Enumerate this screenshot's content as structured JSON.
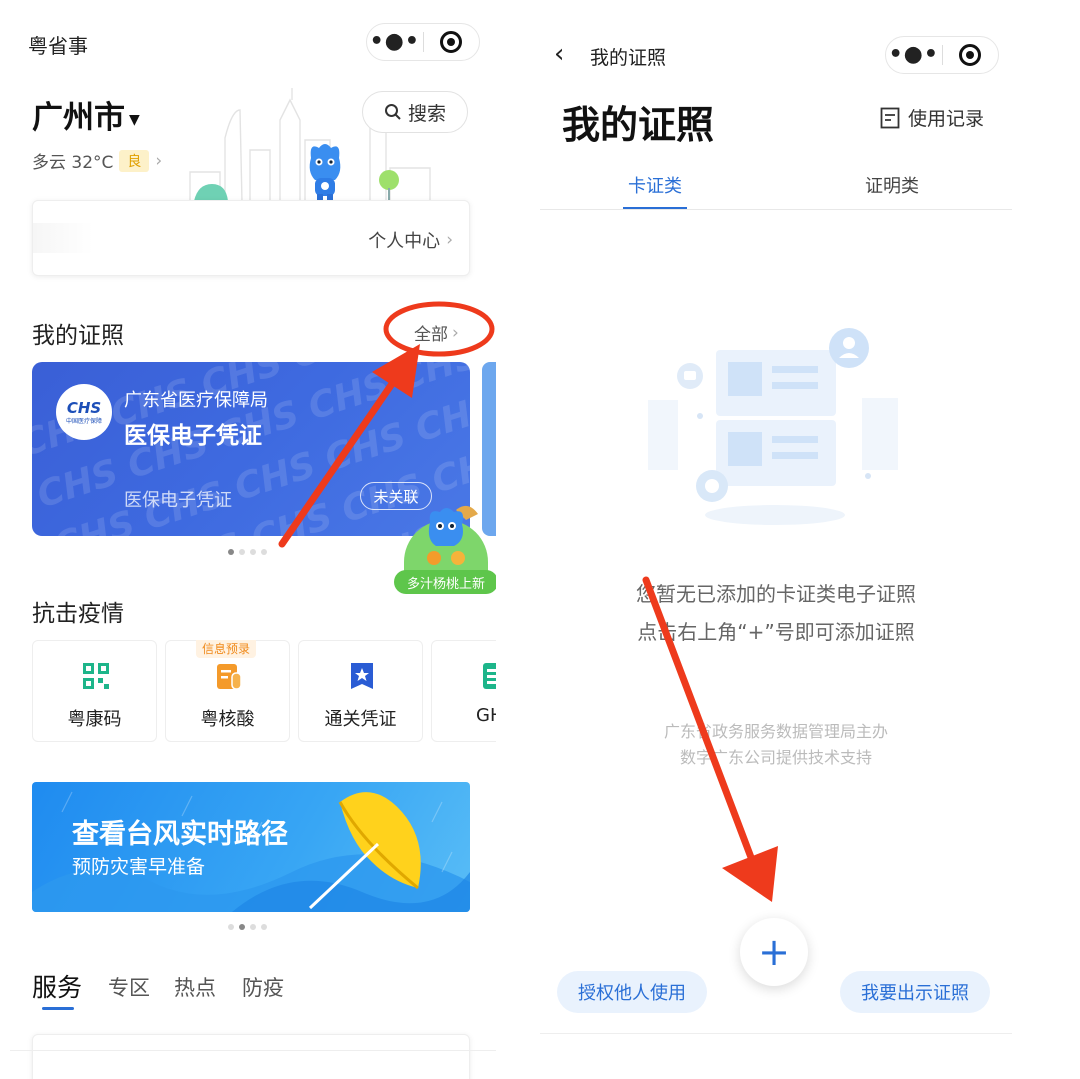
{
  "left": {
    "app_title": "粤省事",
    "city": "广州市",
    "search_label": "搜索",
    "weather": "多云 32°C",
    "air_quality": "良",
    "personal_center": "个人中心",
    "certs_section_title": "我的证照",
    "certs_all_link": "全部",
    "med_card": {
      "org": "广东省医疗保障局",
      "title": "医保电子凭证",
      "subtitle": "医保电子凭证",
      "status": "未关联",
      "logo_text": "CHS",
      "logo_caption": "中国医疗保障"
    },
    "promo_badge": "多汁杨桃上新",
    "epidemic_title": "抗击疫情",
    "epidemic_items": [
      {
        "label": "粤康码",
        "tag": ""
      },
      {
        "label": "粤核酸",
        "tag": "信息预录"
      },
      {
        "label": "通关凭证",
        "tag": ""
      },
      {
        "label": "GH",
        "tag": ""
      }
    ],
    "banner": {
      "title": "查看台风实时路径",
      "subtitle": "预防灾害早准备"
    },
    "bottom_tabs": [
      "服务",
      "专区",
      "热点",
      "防疫"
    ]
  },
  "right": {
    "nav_title": "我的证照",
    "page_title": "我的证照",
    "usage_record": "使用记录",
    "tabs": [
      "卡证类",
      "证明类"
    ],
    "empty_line1": "您暂无已添加的卡证类电子证照",
    "empty_line2": "点击右上角“+”号即可添加证照",
    "footer_line1": "广东省政务服务数据管理局主办",
    "footer_line2": "数字广东公司提供技术支持",
    "fab_label": "+",
    "btn_authorize": "授权他人使用",
    "btn_show": "我要出示证照"
  },
  "colors": {
    "accent_blue": "#2a6fd6",
    "annotation_red": "#ee3a1c",
    "med_card_blue": "#3e6ae0",
    "air_badge_bg": "#fdf1c9"
  },
  "icons": {
    "search": "search-icon",
    "back": "back-chevron-icon",
    "record": "document-icon",
    "more": "more-dots-icon",
    "close_target": "target-icon"
  }
}
